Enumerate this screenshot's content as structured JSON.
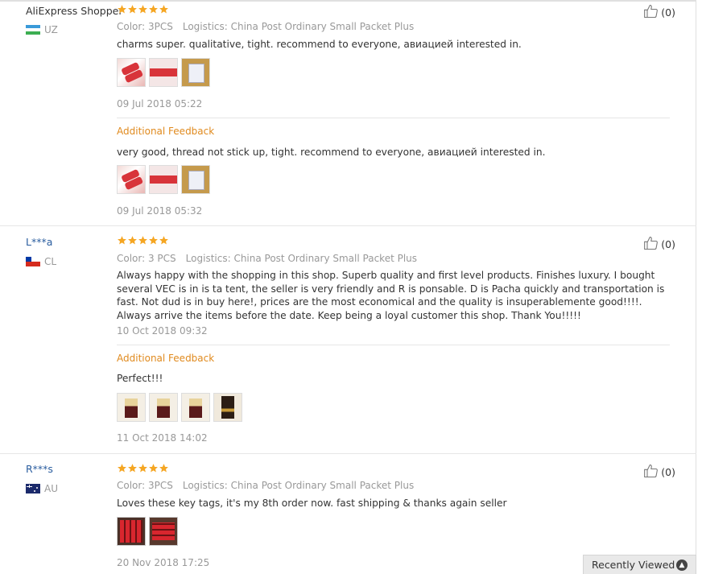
{
  "reviews": [
    {
      "user": "AliExpress Shopper",
      "country": "UZ",
      "rating": 5,
      "likes": "(0)",
      "color": "Color: 3PCS",
      "logistics": "Logistics: China Post Ordinary Small Packet Plus",
      "text": "charms super. qualitative, tight. recommend to everyone, авиацией interested in.",
      "date": "09 Jul 2018 05:22",
      "additional_label": "Additional Feedback",
      "additional_text": "very good, thread not stick up, tight. recommend to everyone, авиацией interested in.",
      "additional_date": "09 Jul 2018 05:32"
    },
    {
      "user": "L***a",
      "country": "CL",
      "rating": 5,
      "likes": "(0)",
      "color": "Color: 3 PCS",
      "logistics": "Logistics: China Post Ordinary Small Packet Plus",
      "text": "Always happy with the shopping in this shop. Superb quality and first level products. Finishes luxury. I bought several VEC is in is ta tent, the seller is very friendly and R is ponsable. D is Pacha quickly and transportation is fast. Not dud is in buy here!, prices are the most economical and the quality is insuperablemente good!!!!. Always arrive the items before the date. Keep being a loyal customer this shop. Thank You!!!!!",
      "date": "10 Oct 2018 09:32",
      "additional_label": "Additional Feedback",
      "additional_text": "Perfect!!!",
      "additional_date": "11 Oct 2018 14:02"
    },
    {
      "user": "R***s",
      "country": "AU",
      "rating": 5,
      "likes": "(0)",
      "color": "Color: 3PCS",
      "logistics": "Logistics: China Post Ordinary Small Packet Plus",
      "text": "Loves these key tags, it's my 8th order now. fast shipping & thanks again seller",
      "date": "20 Nov 2018 17:25"
    }
  ],
  "recently_viewed": "Recently Viewed",
  "colors": {
    "star": "#f5a623",
    "link": "#2a5d9f",
    "additional": "#e08a1e",
    "muted": "#999999"
  },
  "icons": {
    "like": "thumbs-up-icon",
    "star": "star-icon",
    "recent": "chevron-up-icon"
  }
}
